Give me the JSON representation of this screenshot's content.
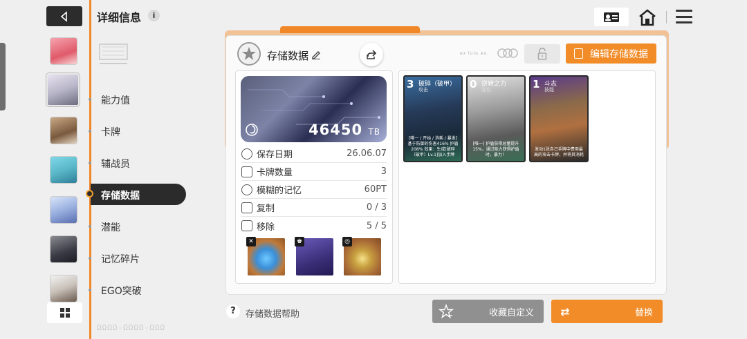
{
  "header": {
    "title": "详细信息",
    "info_icon": "i"
  },
  "nav": {
    "items": [
      {
        "label": "能力值"
      },
      {
        "label": "卡牌"
      },
      {
        "label": "辅战员"
      },
      {
        "label": "存储数据"
      },
      {
        "label": "潜能"
      },
      {
        "label": "记忆碎片"
      },
      {
        "label": "EGO突破"
      }
    ],
    "active_index": 3
  },
  "panel": {
    "title": "存储数据",
    "small_text": "ex lulu ex.",
    "edit_button": "编辑存储数据",
    "banner_value": "46450",
    "banner_unit": "TB",
    "stats": [
      {
        "label": "保存日期",
        "value": "26.06.07",
        "icon": "clock-icon"
      },
      {
        "label": "卡牌数量",
        "value": "3",
        "icon": "cards-icon"
      },
      {
        "label": "模糊的记忆",
        "value": "60PT",
        "icon": "memory-icon"
      },
      {
        "label": "复制",
        "value": "0 / 3",
        "icon": "copy-icon"
      },
      {
        "label": "移除",
        "value": "5 / 5",
        "icon": "remove-icon"
      }
    ],
    "items": [
      {
        "tag": "✕",
        "name": "crystal-orb",
        "color": "#c07a3a"
      },
      {
        "tag": "♚",
        "name": "dark-armor",
        "color": "#4a3d8f"
      },
      {
        "tag": "◎",
        "name": "gold-pendant",
        "color": "#c07a3a"
      }
    ],
    "cards": [
      {
        "cost": "3",
        "name": "破碎（破甲）",
        "type": "攻击",
        "desc": "[唯一 / 开始 / 消耗 / 暴发] 基于防御的伤害416% 护盾208% 效果：生成[破碎（破甲）Lv.1]加入手牌",
        "color": "#2e6b54"
      },
      {
        "cost": "0",
        "name": "逆转之力",
        "type": "强化",
        "desc": "[唯一] 护盾获得总量提升15%，通过能力获得护盾时，暴力！",
        "color": "#3a6e55"
      },
      {
        "cost": "1",
        "name": "斗志",
        "type": "技能",
        "desc": "发动1张自己手牌中费用最高的攻击卡牌，并将其消耗",
        "color": "#2a2a2a"
      }
    ]
  },
  "footer": {
    "help_label": "存储数据帮助",
    "help_icon": "?",
    "favorite_button": "收藏自定义",
    "swap_button": "替换",
    "swap_icon": "⇄"
  },
  "deco_text": "ΩΩΩΩ-ΩΩΩΩ-ΩΩΩ",
  "colors": {
    "accent": "#f28c28",
    "dark": "#2b2b2b",
    "gray_button": "#909090"
  }
}
